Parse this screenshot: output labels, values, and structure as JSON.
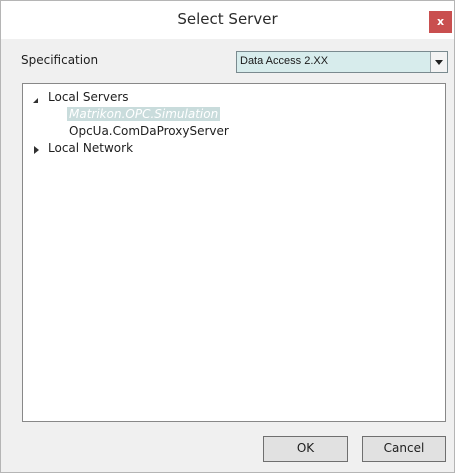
{
  "window": {
    "title": "Select Server",
    "close_glyph": "x"
  },
  "specification": {
    "label": "Specification",
    "selected_value": "Data Access 2.XX"
  },
  "tree": {
    "nodes": [
      {
        "label": "Local Servers",
        "expanded": true,
        "level": 0
      },
      {
        "label": "Matrikon.OPC.Simulation",
        "selected": true,
        "level": 1
      },
      {
        "label": "OpcUa.ComDaProxyServer",
        "level": 1
      },
      {
        "label": "Local Network",
        "expanded": false,
        "level": 0
      }
    ]
  },
  "buttons": {
    "ok_label": "OK",
    "cancel_label": "Cancel"
  },
  "colors": {
    "close_button": "#c94f4f",
    "select_background": "#d7ecec",
    "selection_highlight": "#c9dcdc"
  },
  "icons": {
    "close": "close-icon",
    "dropdown": "chevron-down-icon",
    "expanded": "expand-down-icon",
    "collapsed": "expand-right-icon"
  }
}
